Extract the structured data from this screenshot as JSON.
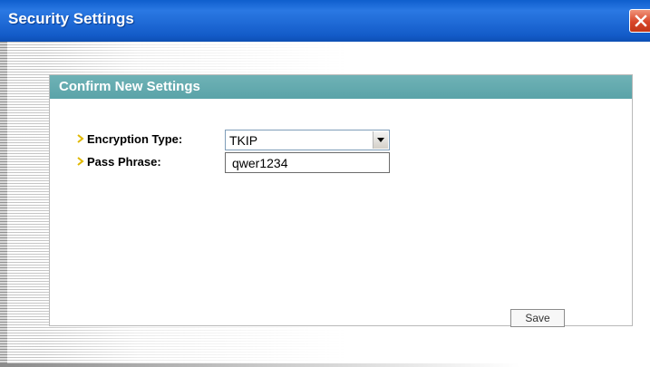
{
  "window": {
    "title": "Security Settings",
    "close_icon": "close-icon",
    "colors": {
      "titlebar": "#1f6ad6",
      "close": "#d8462a"
    }
  },
  "panel": {
    "title": "Confirm New Settings",
    "header_color": "#5aa3a8"
  },
  "form": {
    "encryption": {
      "label": "Encryption Type:",
      "value": "TKIP",
      "bullet_icon": "arrow-bullet-icon"
    },
    "passphrase": {
      "label": "Pass Phrase:",
      "value": "qwer1234",
      "bullet_icon": "arrow-bullet-icon"
    },
    "save_label": "Save"
  }
}
